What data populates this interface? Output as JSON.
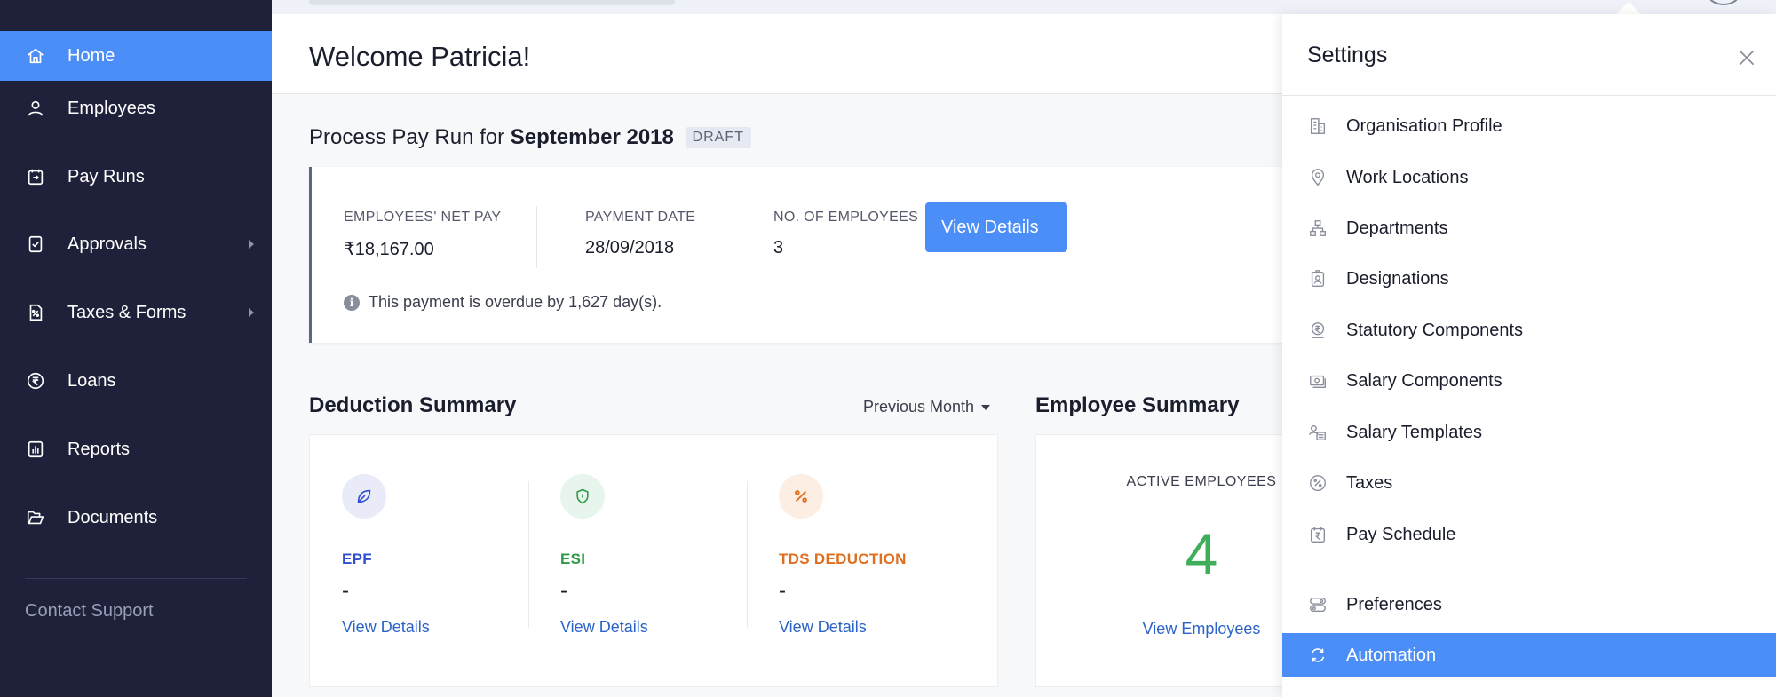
{
  "sidebar": {
    "items": [
      {
        "label": "Home",
        "icon": "home-icon",
        "active": true
      },
      {
        "label": "Employees",
        "icon": "user-icon"
      },
      {
        "label": "Pay Runs",
        "icon": "pay-runs-icon"
      },
      {
        "label": "Approvals",
        "icon": "approvals-icon",
        "submenu": true
      },
      {
        "label": "Taxes & Forms",
        "icon": "taxes-icon",
        "submenu": true
      },
      {
        "label": "Loans",
        "icon": "rupee-circle-icon"
      },
      {
        "label": "Reports",
        "icon": "reports-icon"
      },
      {
        "label": "Documents",
        "icon": "folder-icon"
      }
    ],
    "contact_support": "Contact Support"
  },
  "header": {
    "welcome": "Welcome Patricia!"
  },
  "payrun": {
    "title_prefix": "Process Pay Run for",
    "period": "September 2018",
    "badge": "DRAFT",
    "stats": [
      {
        "label": "EMPLOYEES' NET PAY",
        "value": "₹18,167.00"
      },
      {
        "label": "PAYMENT DATE",
        "value": "28/09/2018"
      },
      {
        "label": "NO. OF EMPLOYEES",
        "value": "3"
      }
    ],
    "overdue_note": "This payment is overdue by 1,627 day(s).",
    "view_details_button": "View Details"
  },
  "deduction_summary": {
    "title": "Deduction Summary",
    "period_select": "Previous Month",
    "items": [
      {
        "name": "EPF",
        "value": "-",
        "link": "View Details",
        "color": "#2f4ed1",
        "icon": "leaf-icon",
        "bg": "#e9ebf8"
      },
      {
        "name": "ESI",
        "value": "-",
        "link": "View Details",
        "color": "#2e9a46",
        "icon": "shield-icon",
        "bg": "#e8f5ec"
      },
      {
        "name": "TDS DEDUCTION",
        "value": "-",
        "link": "View Details",
        "color": "#e06e1f",
        "icon": "percent-icon",
        "bg": "#fdeee4"
      }
    ]
  },
  "employee_summary": {
    "title": "Employee Summary",
    "label": "ACTIVE EMPLOYEES",
    "count": "4",
    "link": "View Employees"
  },
  "settings": {
    "title": "Settings",
    "items": [
      {
        "label": "Organisation Profile",
        "icon": "building-icon"
      },
      {
        "label": "Work Locations",
        "icon": "location-pin-icon"
      },
      {
        "label": "Departments",
        "icon": "org-chart-icon"
      },
      {
        "label": "Designations",
        "icon": "id-badge-icon"
      },
      {
        "label": "Statutory Components",
        "icon": "statutory-icon"
      },
      {
        "label": "Salary Components",
        "icon": "salary-components-icon"
      },
      {
        "label": "Salary Templates",
        "icon": "salary-templates-icon"
      },
      {
        "label": "Taxes",
        "icon": "taxes-icon"
      },
      {
        "label": "Pay Schedule",
        "icon": "calendar-rupee-icon"
      },
      {
        "label": "Preferences",
        "icon": "toggles-icon"
      },
      {
        "label": "Automation",
        "icon": "refresh-icon",
        "active": true
      }
    ]
  },
  "colors": {
    "sidebar_bg": "#1e2139",
    "accent": "#4b8ef7",
    "link": "#2b63c9"
  }
}
